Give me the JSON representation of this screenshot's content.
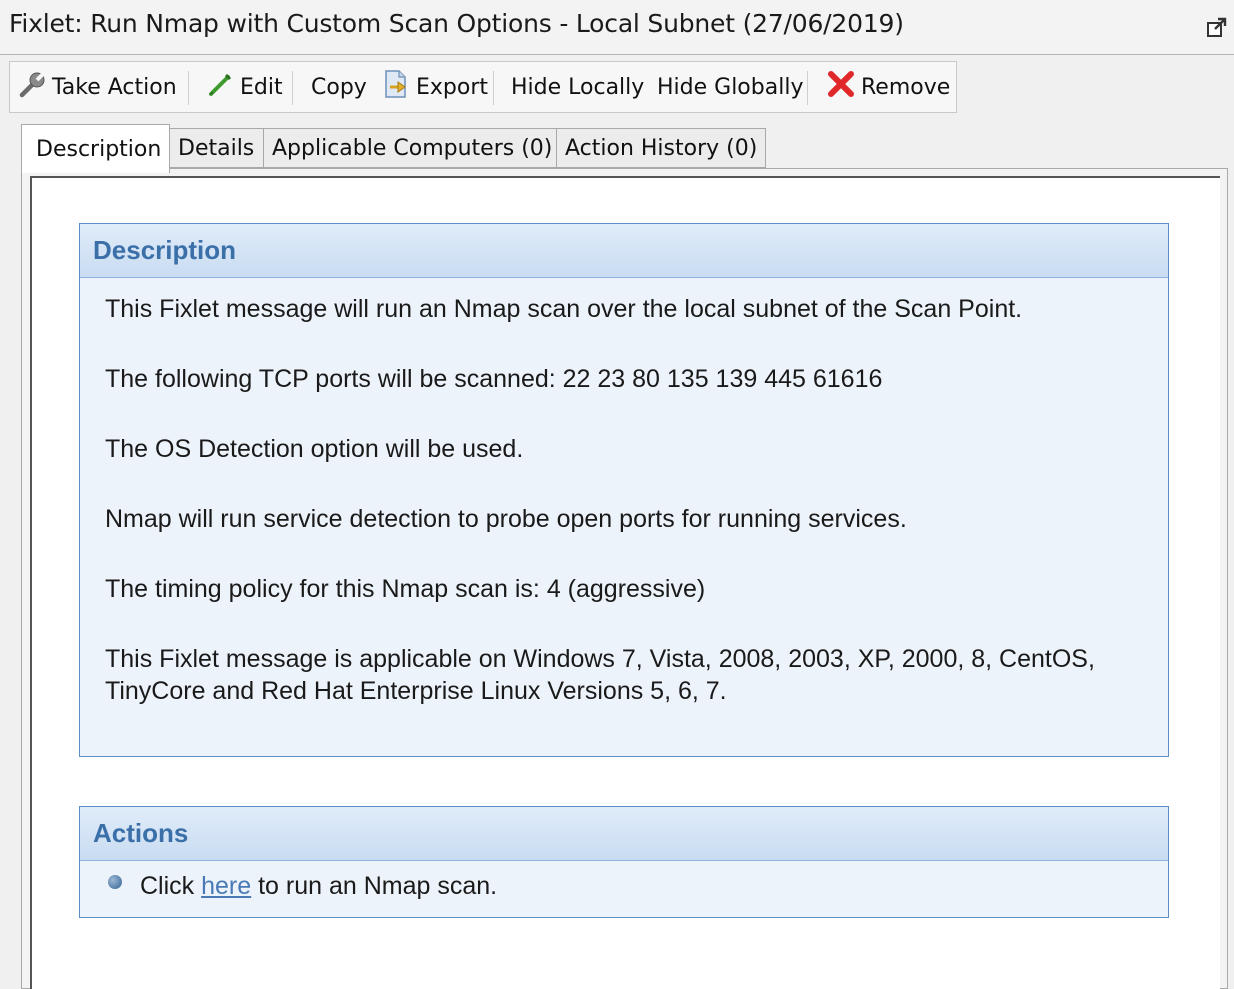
{
  "window": {
    "title": "Fixlet: Run Nmap with Custom Scan Options - Local Subnet (27/06/2019)"
  },
  "toolbar": {
    "take_action": "Take Action",
    "edit": "Edit",
    "copy": "Copy",
    "export": "Export",
    "hide_locally": "Hide Locally",
    "hide_globally": "Hide Globally",
    "remove": "Remove"
  },
  "tabs": [
    {
      "label": "Description",
      "active": true
    },
    {
      "label": "Details",
      "active": false
    },
    {
      "label": "Applicable Computers (0)",
      "active": false
    },
    {
      "label": "Action History (0)",
      "active": false
    }
  ],
  "description": {
    "heading": "Description",
    "paragraphs": [
      "This Fixlet message will run an Nmap scan over the local subnet of the Scan Point.",
      "The following TCP ports will be scanned: 22 23 80 135 139 445 61616",
      "The OS Detection option will be used.",
      "Nmap will run service detection to probe open ports for running services.",
      "The timing policy for this Nmap scan is: 4 (aggressive)",
      "This Fixlet message is applicable on Windows 7, Vista, 2008, 2003, XP, 2000, 8, CentOS, TinyCore and Red Hat Enterprise Linux Versions 5, 6, 7."
    ]
  },
  "actions": {
    "heading": "Actions",
    "items": [
      {
        "prefix": "Click ",
        "link_text": "here",
        "suffix": " to run an Nmap scan."
      }
    ]
  },
  "icons": {
    "take_action": "wrench-icon",
    "edit": "pencil-icon",
    "export": "export-document-icon",
    "remove": "red-x-icon",
    "popout": "popout-window-icon",
    "action_bullet": "blue-bullet-icon"
  },
  "colors": {
    "panel_border": "#5b8fc6",
    "panel_heading_text": "#3a6fa8",
    "link": "#4a7ab5",
    "remove_icon": "#e0282a",
    "edit_icon": "#3c9b2c"
  }
}
